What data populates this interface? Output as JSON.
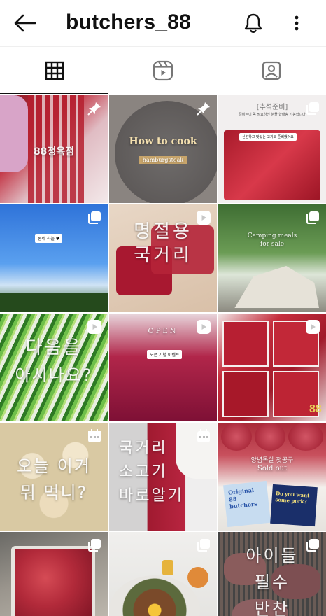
{
  "header": {
    "username": "butchers_88"
  },
  "tabs": [
    {
      "name": "posts-grid",
      "icon": "grid-icon",
      "active": true
    },
    {
      "name": "reels",
      "icon": "reels-icon",
      "active": false
    },
    {
      "name": "tagged",
      "icon": "tagged-icon",
      "active": false
    }
  ],
  "tiles": {
    "t1": {
      "text": "88정육점"
    },
    "t2": {
      "title": "How to cook",
      "subtitle": "hamburgsteak"
    },
    "t3": {
      "title": "[추석준비]",
      "note1": "갈비찜이 꼭 필요하신 분들 합배송 가능합니다",
      "note2": "신선하고 맛있는 고기로 준비했어요"
    },
    "t4": {
      "caption": "동네 하늘 ♥"
    },
    "t5": {
      "line1": "명절용",
      "line2": "국거리"
    },
    "t6": {
      "line1": "Camping meals",
      "line2": "for sale"
    },
    "t7": {
      "line1": "다음을",
      "line2": "아시나요?"
    },
    "t8": {
      "line1": "OPEN",
      "caption": "오픈 기념 이벤트"
    },
    "t9": {
      "tag": "88"
    },
    "t10": {
      "line1": "오늘 이거",
      "line2": "뭐 먹니?"
    },
    "t11": {
      "line1": "국거리",
      "line2": "소고기",
      "line3": "바로알기"
    },
    "t12": {
      "line1": "양념목살 첫공구",
      "line2": "Sold out",
      "box1a": "Original",
      "box1b": "88",
      "box1c": "butchers",
      "box2a": "Do you want",
      "box2b": "some pork?"
    },
    "t15": {
      "line1": "아이들",
      "line2": "필수",
      "line3": "반찬"
    }
  },
  "colors": {
    "accent": "#111111",
    "divider": "#efefef",
    "meat": "#b31d2f",
    "background": "#ffffff"
  }
}
